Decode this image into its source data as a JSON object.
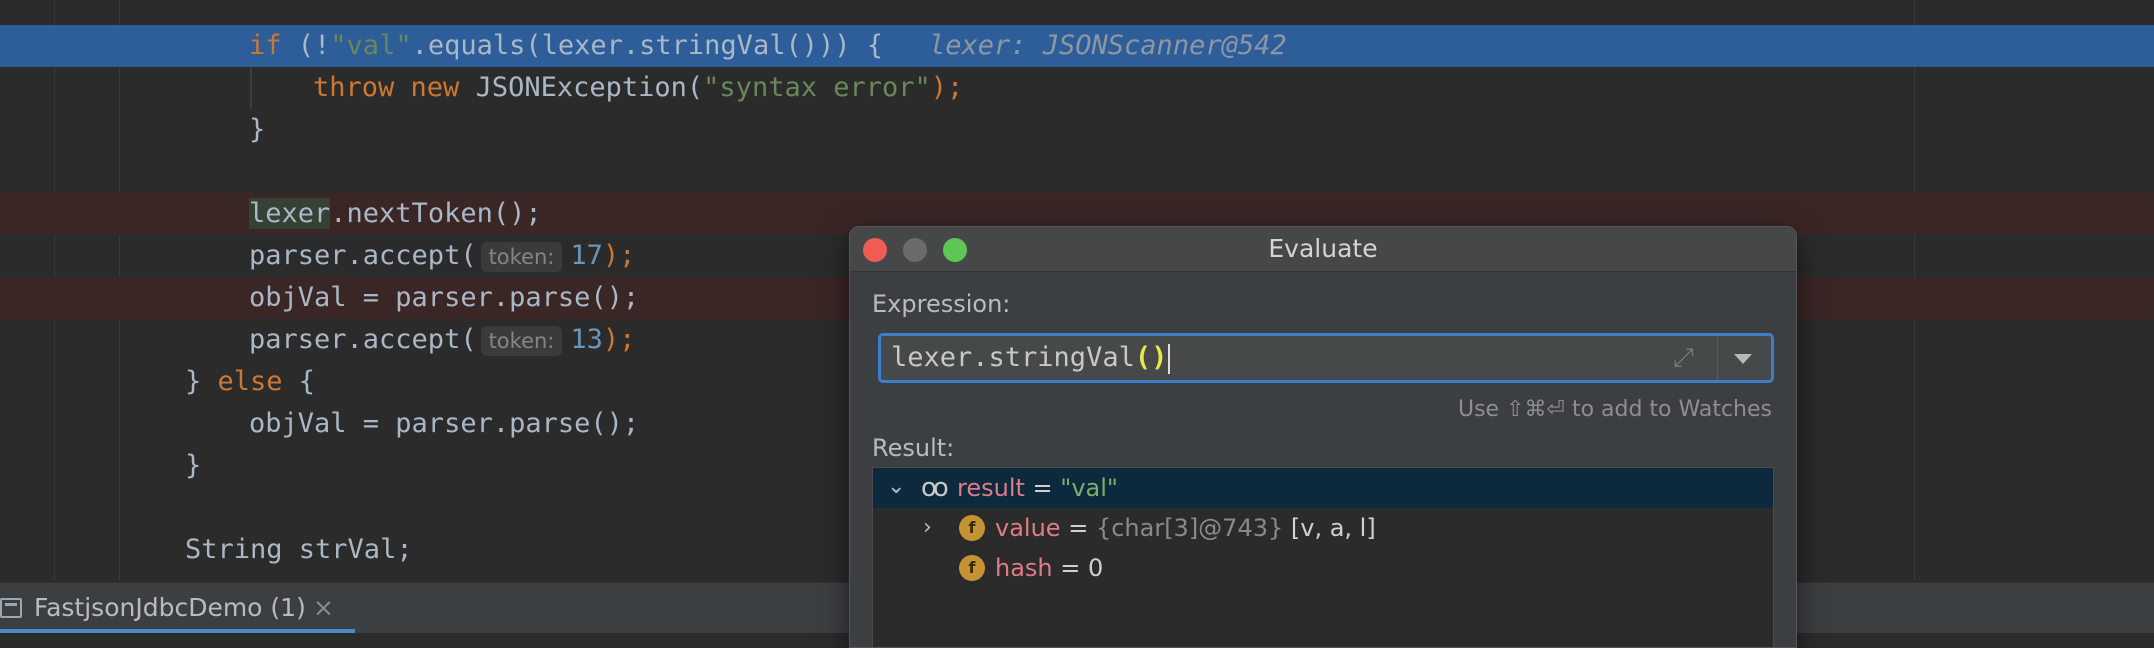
{
  "editor": {
    "inline_debug_value": "lexer: JSONScanner@542",
    "param_hint_token": "token:",
    "lines": {
      "if_keyword": "if",
      "if_open": " (!",
      "if_string": "\"val\"",
      "if_method": ".equals(lexer.stringVal())) {",
      "throw_keyword": "throw",
      "new_keyword": "new",
      "throw_class": " JSONException(",
      "throw_string": "\"syntax error\"",
      "throw_close": ");",
      "close_brace": "}",
      "lexer_var": "lexer",
      "next_token": ".nextToken();",
      "parser_accept": "parser.accept(",
      "accept_value_1": "17",
      "accept_value_2": "13",
      "accept_close": ");",
      "objval_parse": "objVal = parser.parse();",
      "else_close": "} ",
      "else_keyword": "else",
      "else_open": " {",
      "string_decl": "String strVal;"
    }
  },
  "bottom_tab": {
    "label": "FastjsonJdbcDemo (1)",
    "close": "×",
    "icon": "console-icon"
  },
  "evaluate_dialog": {
    "title": "Evaluate",
    "expression_label": "Expression:",
    "expression_prefix": "lexer.stringVal",
    "expression_parens": "()",
    "watch_hint": "Use ⇧⌘⏎ to add to Watches",
    "result_label": "Result:",
    "result": {
      "name": "result",
      "equals": " = ",
      "value": "\"val\"",
      "children": [
        {
          "badge": "f",
          "name": "value",
          "equals": " = ",
          "type": "{char[3]@743}",
          "value": " [v, a, l]"
        },
        {
          "badge": "f",
          "name": "hash",
          "equals": " = ",
          "value": "0"
        }
      ]
    }
  }
}
